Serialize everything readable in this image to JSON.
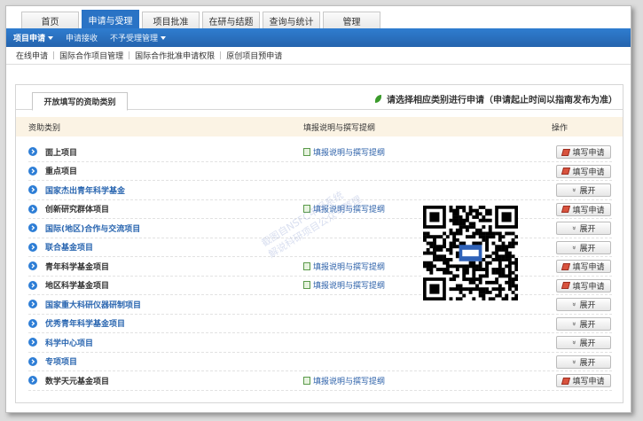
{
  "top_tabs": [
    "首页",
    "申请与受理",
    "项目批准",
    "在研与结题",
    "查询与统计",
    "管理"
  ],
  "active_top_tab": 1,
  "menu": {
    "items": [
      {
        "label": "项目申请",
        "dropdown": true,
        "active": true
      },
      {
        "label": "申请接收",
        "dropdown": false,
        "active": false
      },
      {
        "label": "不予受理管理",
        "dropdown": true,
        "active": false
      }
    ]
  },
  "submenu": [
    "在线申请",
    "国际合作项目管理",
    "国际合作批准申请权限",
    "原创项目预申请"
  ],
  "panel": {
    "tab_label": "开放填写的资助类别",
    "notice": "请选择相应类别进行申请（申请起止时间以指南发布为准）"
  },
  "columns": {
    "category": "资助类别",
    "guide": "填报说明与撰写提纲",
    "action": "操作"
  },
  "rows": [
    {
      "name": "面上项目",
      "guide": "填报说明与撰写提纲",
      "action": "填写申请",
      "type": "fill"
    },
    {
      "name": "重点项目",
      "guide": "",
      "action": "填写申请",
      "type": "fill"
    },
    {
      "name": "国家杰出青年科学基金",
      "guide": "",
      "action": "展开",
      "type": "expand"
    },
    {
      "name": "创新研究群体项目",
      "guide": "填报说明与撰写提纲",
      "action": "填写申请",
      "type": "fill"
    },
    {
      "name": "国际(地区)合作与交流项目",
      "guide": "",
      "action": "展开",
      "type": "expand"
    },
    {
      "name": "联合基金项目",
      "guide": "",
      "action": "展开",
      "type": "expand"
    },
    {
      "name": "青年科学基金项目",
      "guide": "填报说明与撰写提纲",
      "action": "填写申请",
      "type": "fill"
    },
    {
      "name": "地区科学基金项目",
      "guide": "填报说明与撰写提纲",
      "action": "填写申请",
      "type": "fill"
    },
    {
      "name": "国家重大科研仪器研制项目",
      "guide": "",
      "action": "展开",
      "type": "expand"
    },
    {
      "name": "优秀青年科学基金项目",
      "guide": "",
      "action": "展开",
      "type": "expand"
    },
    {
      "name": "科学中心项目",
      "guide": "",
      "action": "展开",
      "type": "expand"
    },
    {
      "name": "专项项目",
      "guide": "",
      "action": "展开",
      "type": "expand"
    },
    {
      "name": "数学天元基金项目",
      "guide": "填报说明与撰写提纲",
      "action": "填写申请",
      "type": "fill"
    }
  ],
  "watermark": [
    "截图自NSFC申报系统",
    "解说科研项目公众号整理"
  ],
  "colors": {
    "accent": "#2a73c5",
    "header_bg": "#fbf3e4",
    "link": "#2a5fa8"
  }
}
